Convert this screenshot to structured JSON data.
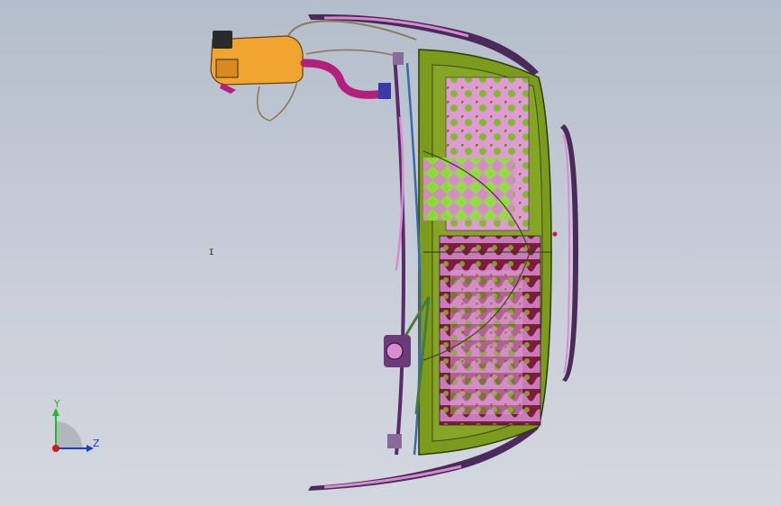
{
  "viewport": {
    "background_top": "#b4bdcb",
    "background_bottom": "#d3d7df"
  },
  "model": {
    "panel_color": "#7c9a1c",
    "mesh_light_color": "#d98ad0",
    "mesh_dark_color": "#7a1c3a",
    "mesh_green_color": "#8ee23a",
    "reservoir_color": "#f0a531",
    "hose_color": "#b2207e",
    "wire_color": "#8a7a5a",
    "frame_color": "#4a2a5a"
  },
  "cursor": {
    "glyph": "I"
  },
  "triad": {
    "y_label": "Y",
    "z_label": "Z",
    "y_color": "#24b82a",
    "z_color": "#1e3cc8",
    "origin_color": "#d11a1a",
    "icons": [
      "y-axis-arrow-icon",
      "z-axis-arrow-icon",
      "x-axis-origin-icon"
    ]
  }
}
